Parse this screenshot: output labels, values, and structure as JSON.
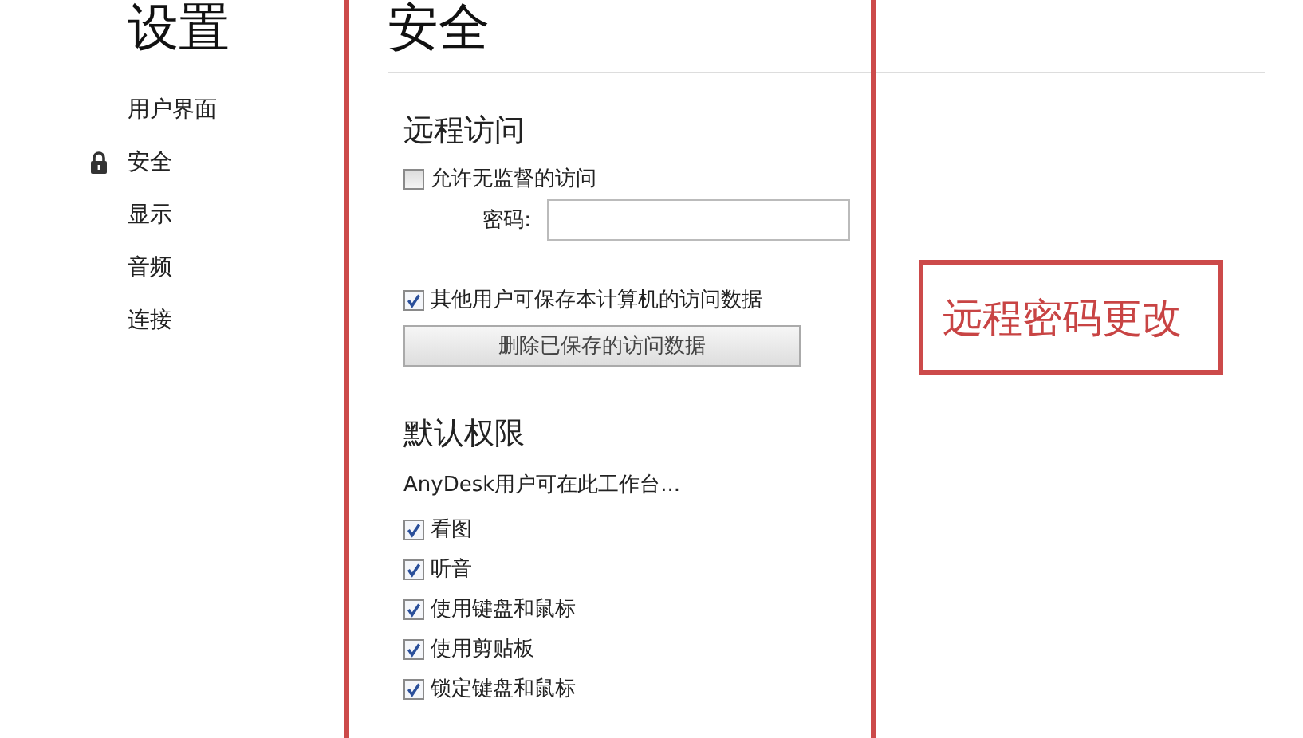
{
  "sidebar": {
    "title": "设置",
    "items": [
      {
        "label": "用户界面",
        "selected": false
      },
      {
        "label": "安全",
        "selected": true
      },
      {
        "label": "显示",
        "selected": false
      },
      {
        "label": "音频",
        "selected": false
      },
      {
        "label": "连接",
        "selected": false
      }
    ]
  },
  "page_title": "安全",
  "remote_access": {
    "heading": "远程访问",
    "unattended": {
      "label": "允许无监督的访问",
      "checked": false
    },
    "password": {
      "label": "密码:"
    },
    "save_data": {
      "label": "其他用户可保存本计算机的访问数据",
      "checked": true
    },
    "button": "删除已保存的访问数据"
  },
  "permissions": {
    "heading": "默认权限",
    "description": "AnyDesk用户可在此工作台...",
    "options": [
      {
        "label": "看图",
        "checked": true
      },
      {
        "label": "听音",
        "checked": true
      },
      {
        "label": "使用键盘和鼠标",
        "checked": true
      },
      {
        "label": "使用剪贴板",
        "checked": true
      },
      {
        "label": "锁定键盘和鼠标",
        "checked": true
      }
    ]
  },
  "annotation": "远程密码更改"
}
